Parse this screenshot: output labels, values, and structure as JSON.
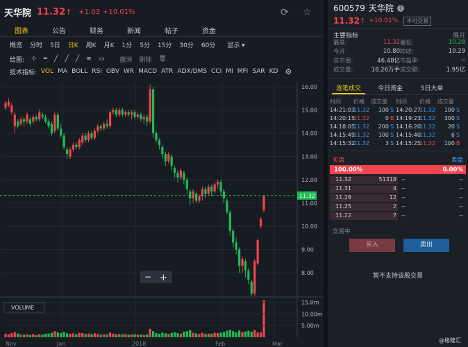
{
  "header": {
    "name": "天华院",
    "price": "11.32",
    "arrow": "↑",
    "change": "+1.03",
    "percent": "+10.01%",
    "refresh_icon": "refresh-icon",
    "star_icon": "star-icon"
  },
  "tabs": [
    {
      "label": "图表",
      "active": true
    },
    {
      "label": "公告"
    },
    {
      "label": "财务"
    },
    {
      "label": "新闻"
    },
    {
      "label": "帖子"
    },
    {
      "label": "资金"
    }
  ],
  "periods": [
    {
      "label": "概览"
    },
    {
      "label": "分时"
    },
    {
      "label": "5日"
    },
    {
      "label": "日K",
      "active": true
    },
    {
      "label": "周K"
    },
    {
      "label": "月K"
    },
    {
      "label": "1分"
    },
    {
      "label": "5分"
    },
    {
      "label": "15分"
    },
    {
      "label": "30分"
    },
    {
      "label": "60分"
    },
    {
      "label": "显示 ▾"
    }
  ],
  "draw": {
    "label": "绘图:",
    "undo": "撤消",
    "delete": "删除"
  },
  "indicators": {
    "label": "技术指标:",
    "items": [
      {
        "label": "VOL",
        "active": true
      },
      {
        "label": "MA"
      },
      {
        "label": "BOLL"
      },
      {
        "label": "RSI"
      },
      {
        "label": "OBV"
      },
      {
        "label": "WR"
      },
      {
        "label": "MACD"
      },
      {
        "label": "ATR"
      },
      {
        "label": "ADX/DMS"
      },
      {
        "label": "CCI"
      },
      {
        "label": "MI"
      },
      {
        "label": "MFI"
      },
      {
        "label": "SAR"
      },
      {
        "label": "KD"
      }
    ]
  },
  "chart": {
    "price_ticks": [
      "16.00",
      "15.00",
      "14.00",
      "13.00",
      "12.00",
      "11.00",
      "10.00",
      "9.00",
      "8.00"
    ],
    "current_label": "11.32",
    "vol_label": "VOLUME",
    "vol_ticks": [
      "15.0m",
      "10.00m",
      "5.00m"
    ],
    "x_labels": [
      "Nov",
      "Jan",
      "2018",
      "Feb",
      "Mar"
    ],
    "zoom_out": "−",
    "zoom_in": "+",
    "watermark": "@格隆汇",
    "candles": [
      {
        "o": 15.1,
        "c": 15.3,
        "h": 15.4,
        "l": 15.0
      },
      {
        "o": 15.2,
        "c": 15.35,
        "h": 15.5,
        "l": 15.1
      },
      {
        "o": 14.9,
        "c": 15.2,
        "h": 15.3,
        "l": 14.8
      },
      {
        "o": 14.3,
        "c": 14.8,
        "h": 14.9,
        "l": 14.0
      },
      {
        "o": 14.5,
        "c": 14.3,
        "h": 14.6,
        "l": 14.2
      },
      {
        "o": 14.4,
        "c": 14.6,
        "h": 14.7,
        "l": 14.3
      },
      {
        "o": 14.6,
        "c": 14.5,
        "h": 14.7,
        "l": 14.3
      },
      {
        "o": 14.5,
        "c": 14.8,
        "h": 14.9,
        "l": 14.4
      },
      {
        "o": 14.6,
        "c": 14.4,
        "h": 14.7,
        "l": 14.3
      },
      {
        "o": 14.5,
        "c": 14.7,
        "h": 14.8,
        "l": 14.4
      },
      {
        "o": 14.7,
        "c": 14.6,
        "h": 14.8,
        "l": 14.5
      },
      {
        "o": 14.6,
        "c": 14.9,
        "h": 15.0,
        "l": 14.5
      },
      {
        "o": 14.8,
        "c": 14.7,
        "h": 14.9,
        "l": 14.6
      },
      {
        "o": 14.7,
        "c": 14.5,
        "h": 14.8,
        "l": 14.4
      },
      {
        "o": 14.5,
        "c": 14.3,
        "h": 14.6,
        "l": 14.2
      },
      {
        "o": 14.4,
        "c": 14.0,
        "h": 14.5,
        "l": 13.9
      },
      {
        "o": 14.1,
        "c": 14.8,
        "h": 14.9,
        "l": 14.0
      },
      {
        "o": 14.8,
        "c": 14.2,
        "h": 14.9,
        "l": 14.1
      },
      {
        "o": 14.2,
        "c": 13.9,
        "h": 14.4,
        "l": 13.8
      },
      {
        "o": 13.9,
        "c": 13.4,
        "h": 14.0,
        "l": 13.3
      },
      {
        "o": 13.3,
        "c": 13.1,
        "h": 13.4,
        "l": 12.9
      },
      {
        "o": 13.0,
        "c": 13.3,
        "h": 13.4,
        "l": 12.9
      },
      {
        "o": 13.3,
        "c": 13.5,
        "h": 13.6,
        "l": 13.2
      },
      {
        "o": 13.5,
        "c": 13.4,
        "h": 13.6,
        "l": 13.3
      },
      {
        "o": 13.4,
        "c": 13.7,
        "h": 13.8,
        "l": 13.3
      },
      {
        "o": 13.6,
        "c": 13.9,
        "h": 14.0,
        "l": 13.5
      },
      {
        "o": 13.9,
        "c": 13.7,
        "h": 14.0,
        "l": 13.6
      },
      {
        "o": 13.7,
        "c": 14.0,
        "h": 14.1,
        "l": 13.6
      },
      {
        "o": 14.0,
        "c": 13.8,
        "h": 14.1,
        "l": 13.7
      },
      {
        "o": 13.8,
        "c": 14.1,
        "h": 14.2,
        "l": 13.7
      },
      {
        "o": 14.1,
        "c": 14.3,
        "h": 14.4,
        "l": 14.0
      },
      {
        "o": 14.3,
        "c": 14.2,
        "h": 14.4,
        "l": 14.1
      },
      {
        "o": 14.2,
        "c": 14.4,
        "h": 14.5,
        "l": 14.1
      },
      {
        "o": 14.4,
        "c": 14.3,
        "h": 14.6,
        "l": 14.2
      },
      {
        "o": 14.3,
        "c": 14.9,
        "h": 15.0,
        "l": 14.2
      },
      {
        "o": 14.9,
        "c": 15.0,
        "h": 15.1,
        "l": 14.8
      },
      {
        "o": 15.0,
        "c": 14.8,
        "h": 15.1,
        "l": 14.7
      },
      {
        "o": 14.8,
        "c": 15.0,
        "h": 15.1,
        "l": 14.7
      },
      {
        "o": 15.0,
        "c": 14.8,
        "h": 15.1,
        "l": 14.7
      },
      {
        "o": 14.8,
        "c": 14.9,
        "h": 15.0,
        "l": 14.7
      },
      {
        "o": 14.9,
        "c": 14.8,
        "h": 15.0,
        "l": 14.7
      },
      {
        "o": 14.8,
        "c": 14.9,
        "h": 15.0,
        "l": 14.6
      },
      {
        "o": 14.9,
        "c": 14.7,
        "h": 15.0,
        "l": 14.6
      },
      {
        "o": 14.7,
        "c": 14.8,
        "h": 14.9,
        "l": 14.6
      },
      {
        "o": 14.8,
        "c": 14.6,
        "h": 14.9,
        "l": 14.5
      },
      {
        "o": 14.6,
        "c": 14.7,
        "h": 14.8,
        "l": 14.4
      },
      {
        "o": 14.7,
        "c": 14.5,
        "h": 14.8,
        "l": 14.3
      },
      {
        "o": 14.5,
        "c": 15.9,
        "h": 16.1,
        "l": 14.4
      },
      {
        "o": 15.9,
        "c": 14.0,
        "h": 16.0,
        "l": 13.8
      },
      {
        "o": 14.0,
        "c": 13.7,
        "h": 14.1,
        "l": 13.6
      },
      {
        "o": 13.7,
        "c": 13.5,
        "h": 13.8,
        "l": 13.3
      },
      {
        "o": 13.4,
        "c": 13.1,
        "h": 13.5,
        "l": 12.9
      },
      {
        "o": 13.1,
        "c": 12.8,
        "h": 13.2,
        "l": 12.6
      },
      {
        "o": 12.8,
        "c": 13.1,
        "h": 13.2,
        "l": 12.7
      },
      {
        "o": 13.0,
        "c": 12.6,
        "h": 13.1,
        "l": 12.4
      },
      {
        "o": 12.5,
        "c": 12.3,
        "h": 12.6,
        "l": 12.1
      },
      {
        "o": 12.3,
        "c": 12.1,
        "h": 12.4,
        "l": 11.9
      },
      {
        "o": 12.1,
        "c": 12.4,
        "h": 12.5,
        "l": 12.0
      },
      {
        "o": 12.3,
        "c": 12.0,
        "h": 12.4,
        "l": 11.8
      },
      {
        "o": 12.0,
        "c": 11.6,
        "h": 12.1,
        "l": 11.4
      },
      {
        "o": 11.5,
        "c": 11.2,
        "h": 11.6,
        "l": 10.9
      },
      {
        "o": 11.2,
        "c": 11.5,
        "h": 11.6,
        "l": 11.0
      },
      {
        "o": 11.4,
        "c": 11.1,
        "h": 11.5,
        "l": 11.0
      },
      {
        "o": 11.1,
        "c": 11.3,
        "h": 11.4,
        "l": 11.0
      },
      {
        "o": 11.3,
        "c": 11.6,
        "h": 11.7,
        "l": 11.1
      },
      {
        "o": 11.6,
        "c": 11.4,
        "h": 11.7,
        "l": 11.2
      },
      {
        "o": 11.4,
        "c": 11.7,
        "h": 11.8,
        "l": 11.3
      },
      {
        "o": 11.7,
        "c": 11.5,
        "h": 11.8,
        "l": 11.3
      },
      {
        "o": 11.5,
        "c": 11.8,
        "h": 11.9,
        "l": 11.4
      },
      {
        "o": 11.8,
        "c": 11.9,
        "h": 12.0,
        "l": 11.6
      },
      {
        "o": 11.9,
        "c": 11.5,
        "h": 12.0,
        "l": 11.3
      },
      {
        "o": 11.5,
        "c": 11.2,
        "h": 11.6,
        "l": 11.0
      },
      {
        "o": 11.1,
        "c": 10.6,
        "h": 11.2,
        "l": 10.5
      },
      {
        "o": 10.6,
        "c": 9.8,
        "h": 10.7,
        "l": 9.6
      },
      {
        "o": 9.8,
        "c": 9.3,
        "h": 9.9,
        "l": 9.1
      },
      {
        "o": 9.3,
        "c": 9.0,
        "h": 9.5,
        "l": 8.8
      },
      {
        "o": 9.0,
        "c": 8.3,
        "h": 9.1,
        "l": 8.0
      },
      {
        "o": 8.3,
        "c": 8.6,
        "h": 8.7,
        "l": 8.0
      },
      {
        "o": 8.5,
        "c": 8.1,
        "h": 8.6,
        "l": 7.8
      },
      {
        "o": 8.1,
        "c": 7.7,
        "h": 8.2,
        "l": 7.5
      },
      {
        "o": 7.6,
        "c": 7.1,
        "h": 7.7,
        "l": 7.0
      },
      {
        "o": 7.1,
        "c": 8.5,
        "h": 8.6,
        "l": 7.0
      },
      {
        "o": 8.4,
        "c": 9.4,
        "h": 9.5,
        "l": 8.3
      },
      {
        "o": 10.0,
        "c": 10.3,
        "h": 10.4,
        "l": 9.9
      },
      {
        "o": 10.7,
        "c": 11.32,
        "h": 11.32,
        "l": 10.6
      }
    ],
    "volumes": [
      1.5,
      1.3,
      1.8,
      2.2,
      1.6,
      1.2,
      1.1,
      1.3,
      1.0,
      1.4,
      0.9,
      1.3,
      1.1,
      1.5,
      1.6,
      1.9,
      2.6,
      2.1,
      1.8,
      2.3,
      1.7,
      1.5,
      1.6,
      1.3,
      1.9,
      1.8,
      1.4,
      1.6,
      1.3,
      1.7,
      1.5,
      1.1,
      1.3,
      1.2,
      2.0,
      1.6,
      1.3,
      1.4,
      1.2,
      1.3,
      1.1,
      1.2,
      1.3,
      1.1,
      1.2,
      1.0,
      1.3,
      3.6,
      2.6,
      1.8,
      1.5,
      2.0,
      1.7,
      1.4,
      1.9,
      2.1,
      1.8,
      1.5,
      2.4,
      2.6,
      3.1,
      1.9,
      1.6,
      1.5,
      1.9,
      1.4,
      1.6,
      1.5,
      1.9,
      1.8,
      2.0,
      2.3,
      2.8,
      3.2,
      2.6,
      2.1,
      2.9,
      2.2,
      2.5,
      2.8,
      2.4,
      3.0,
      2.0,
      2.1,
      15.8
    ]
  },
  "right": {
    "code": "600579",
    "name": "天华院",
    "help_icon": "help-icon",
    "price": "11.32",
    "arrow": "↑",
    "percent": "+10.01%",
    "badge": "不可交易",
    "section": "主要指标",
    "expand": "展开",
    "metrics": [
      [
        "最高:",
        "11.32",
        "最低:",
        "10.28"
      ],
      [
        "今开:",
        "10.80",
        "昨收:",
        "10.29"
      ],
      [
        "总市值:",
        "46.48亿",
        "市盈率:",
        "--"
      ],
      [
        "成交量:",
        "18.26万手",
        "成交额:",
        "1.95亿"
      ]
    ],
    "trade_tabs": [
      {
        "label": "逐笔成交",
        "active": true
      },
      {
        "label": "今日资金"
      },
      {
        "label": "5日大单"
      }
    ],
    "trade_head": [
      "时间",
      "价格",
      "成交量",
      "时间",
      "价格",
      "成交量"
    ],
    "trades": [
      [
        {
          "t": "14:21:03",
          "p": "11.32",
          "pc": "blue",
          "v": "100",
          "s": "S",
          "sc": "blue"
        },
        {
          "t": "14:20:27",
          "p": "11.32",
          "pc": "blue",
          "v": "100",
          "s": "S",
          "sc": "blue"
        }
      ],
      [
        {
          "t": "14:20:15",
          "p": "11.32",
          "pc": "red",
          "v": "0",
          "s": "B",
          "sc": "red"
        },
        {
          "t": "14:19:23",
          "p": "11.32",
          "pc": "blue",
          "v": "300",
          "s": "S",
          "sc": "blue"
        }
      ],
      [
        {
          "t": "14:18:05",
          "p": "11.32",
          "pc": "blue",
          "v": "200",
          "s": "S",
          "sc": "blue"
        },
        {
          "t": "14:16:20",
          "p": "11.32",
          "pc": "blue",
          "v": "20",
          "s": "S",
          "sc": "blue"
        }
      ],
      [
        {
          "t": "14:15:49",
          "p": "11.32",
          "pc": "blue",
          "v": "100",
          "s": "S",
          "sc": "blue"
        },
        {
          "t": "14:15:40",
          "p": "11.32",
          "pc": "blue",
          "v": "6",
          "s": "S",
          "sc": "blue"
        }
      ],
      [
        {
          "t": "14:15:32",
          "p": "11.32",
          "pc": "blue",
          "v": "3",
          "s": "S",
          "sc": "blue"
        },
        {
          "t": "14:15:25",
          "p": "11.32",
          "pc": "red",
          "v": "100",
          "s": "B",
          "sc": "red"
        }
      ]
    ],
    "buy_label": "买盘",
    "sell_label": "卖盘",
    "bar_left": "100.00%",
    "bar_right": "0.00%",
    "book": [
      {
        "p": "11.32",
        "v": "51318",
        "r1": "--",
        "r2": "--"
      },
      {
        "p": "11.31",
        "v": "4",
        "r1": "--",
        "r2": "--"
      },
      {
        "p": "11.28",
        "v": "12",
        "r1": "--",
        "r2": "--"
      },
      {
        "p": "11.25",
        "v": "2",
        "r1": "--",
        "r2": "--"
      },
      {
        "p": "11.22",
        "v": "7",
        "r1": "--",
        "r2": "--"
      }
    ],
    "trading_label": "交易中",
    "buy_btn": "买入",
    "sell_btn": "卖出",
    "notice": "暂不支持该股交易"
  }
}
